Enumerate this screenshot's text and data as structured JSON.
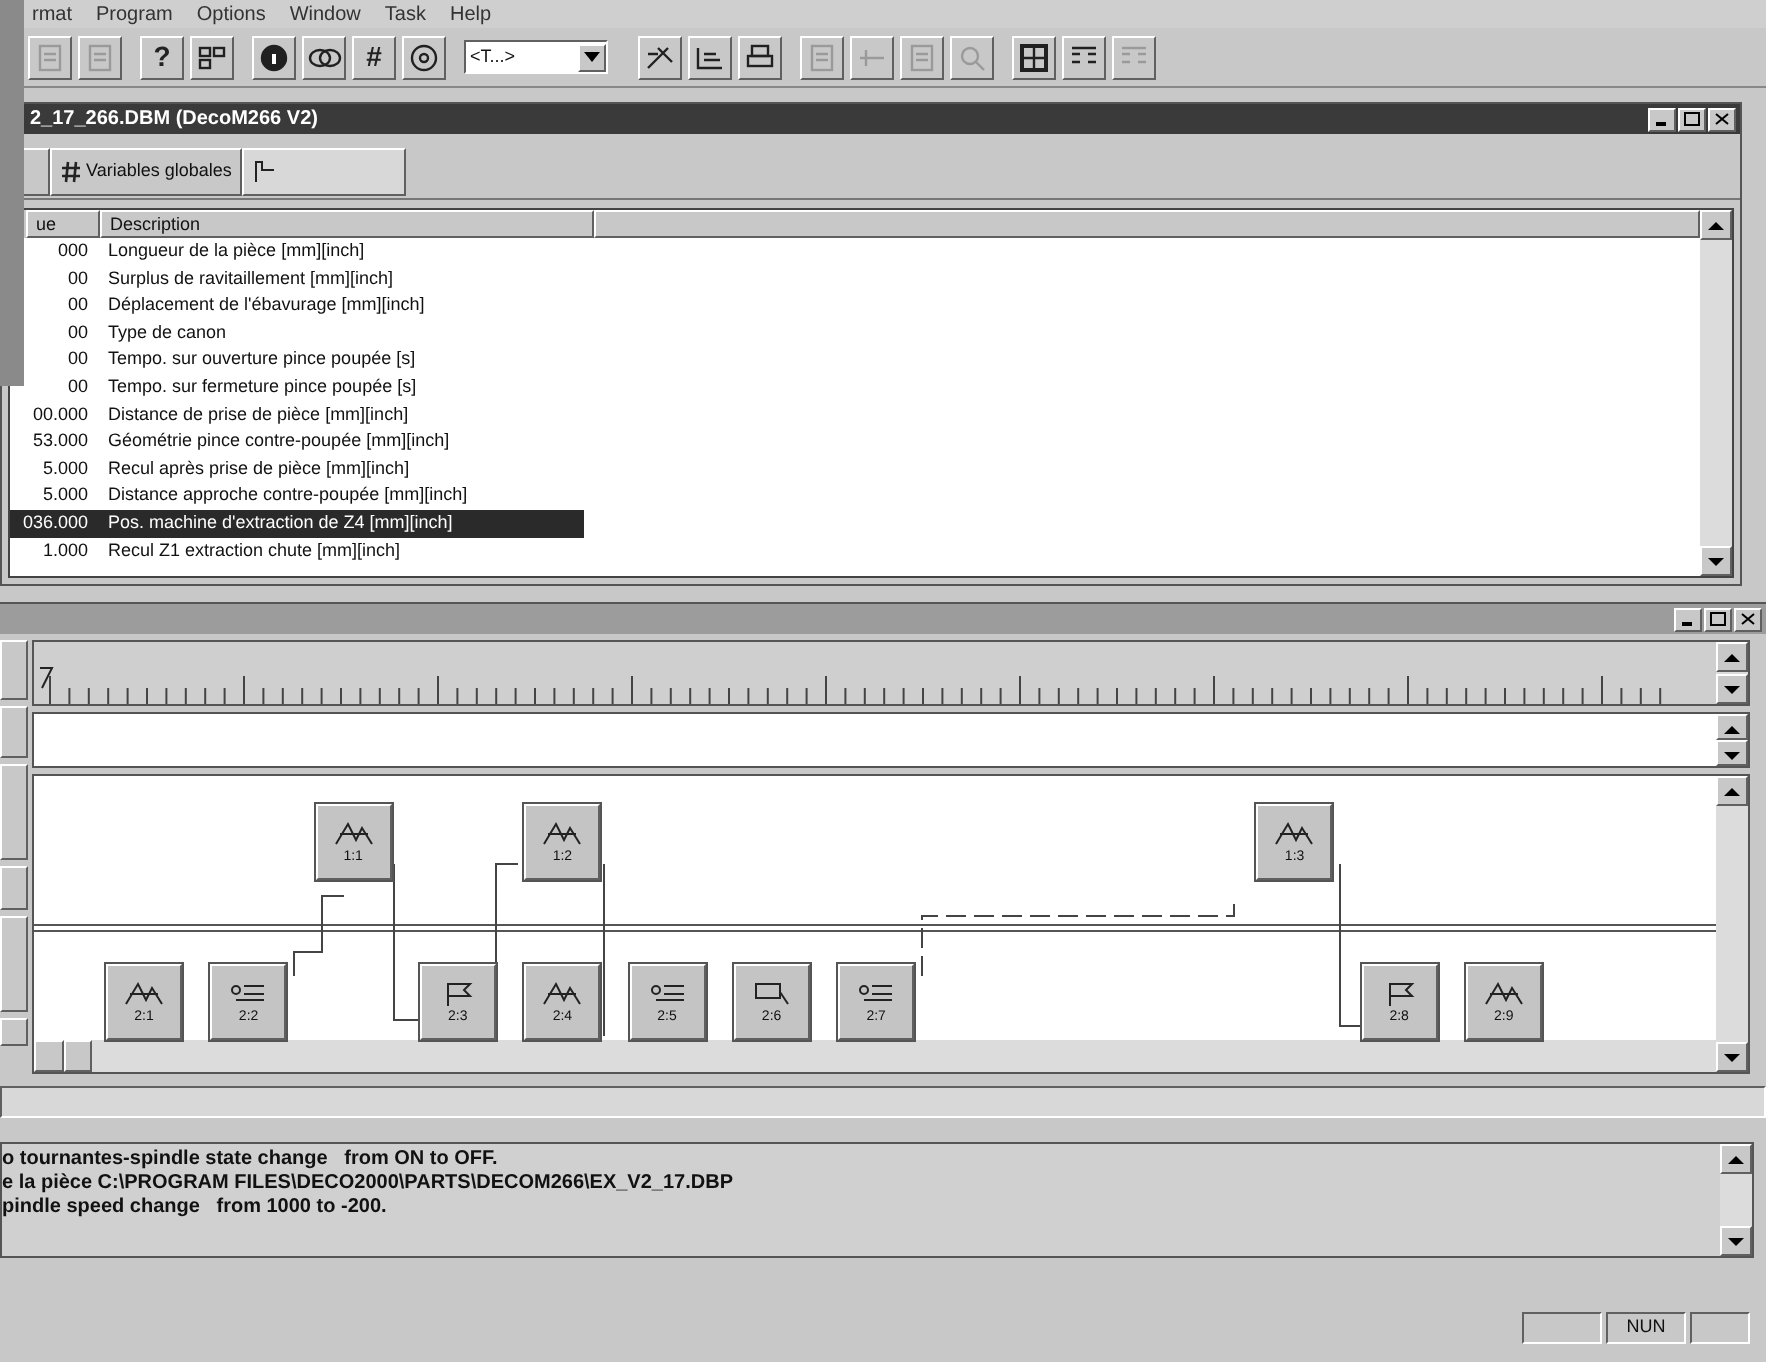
{
  "menu_bar": [
    "rmat",
    "Program",
    "Options",
    "Window",
    "Task",
    "Help"
  ],
  "toolbar": [
    {
      "kind": "page",
      "disabled": true
    },
    {
      "kind": "page",
      "disabled": true
    },
    {
      "kind": "glyph",
      "label": "?",
      "disabled": false
    },
    {
      "kind": "grid",
      "disabled": false
    },
    {
      "kind": "info",
      "disabled": false
    },
    {
      "kind": "link",
      "disabled": false
    },
    {
      "kind": "glyph",
      "label": "#",
      "disabled": false
    },
    {
      "kind": "disk",
      "disabled": false
    },
    {
      "kind": "combo",
      "value": "<T...>",
      "disabled": false
    },
    {
      "kind": "tool",
      "disabled": false
    },
    {
      "kind": "save",
      "disabled": false
    },
    {
      "kind": "print",
      "disabled": false
    },
    {
      "kind": "page",
      "disabled": true
    },
    {
      "kind": "cut",
      "disabled": true
    },
    {
      "kind": "page",
      "disabled": true
    },
    {
      "kind": "find",
      "disabled": true
    },
    {
      "kind": "window",
      "disabled": false
    },
    {
      "kind": "tile",
      "disabled": false
    },
    {
      "kind": "tile",
      "disabled": true
    }
  ],
  "document_window": {
    "title": "2_17_266.DBM (DecoM266 V2)",
    "tabs": [
      {
        "kind": "blank",
        "selected": false
      },
      {
        "label": "Variables globales",
        "kind": "hash",
        "selected": false
      },
      {
        "kind": "flag",
        "selected": true
      }
    ],
    "table": {
      "columns": [
        "ue",
        "Description"
      ],
      "rows": [
        {
          "value": "000",
          "description": "Longueur de la pièce [mm][inch]",
          "selected": false
        },
        {
          "value": "00",
          "description": "Surplus de ravitaillement [mm][inch]",
          "selected": false
        },
        {
          "value": "00",
          "description": "Déplacement de l'ébavurage [mm][inch]",
          "selected": false
        },
        {
          "value": "00",
          "description": "Type de canon",
          "selected": false
        },
        {
          "value": "00",
          "description": "Tempo. sur ouverture pince poupée [s]",
          "selected": false
        },
        {
          "value": "00",
          "description": "Tempo. sur fermeture pince poupée [s]",
          "selected": false
        },
        {
          "value": "00.000",
          "description": "Distance de prise de pièce [mm][inch]",
          "selected": false
        },
        {
          "value": "53.000",
          "description": "Géométrie pince contre-poupée [mm][inch]",
          "selected": false
        },
        {
          "value": "5.000",
          "description": "Recul après prise de pièce [mm][inch]",
          "selected": false
        },
        {
          "value": "5.000",
          "description": "Distance approche contre-poupée [mm][inch]",
          "selected": false
        },
        {
          "value": "036.000",
          "description": "Pos. machine d'extraction de Z4 [mm][inch]",
          "selected": true
        },
        {
          "value": "1.000",
          "description": "Recul Z1 extraction chute [mm][inch]",
          "selected": false
        }
      ]
    }
  },
  "diagram_window": {
    "lanes": [
      {
        "nodes": [
          {
            "label": "1:1",
            "kind": "spindle"
          },
          {
            "label": "1:2",
            "kind": "spindle"
          },
          {
            "label": "1:3",
            "kind": "spindle"
          }
        ]
      },
      {
        "nodes": [
          {
            "label": "2:1",
            "kind": "spindle"
          },
          {
            "label": "2:2",
            "kind": "list"
          },
          {
            "label": "2:3",
            "kind": "flag"
          },
          {
            "label": "2:4",
            "kind": "spindle"
          },
          {
            "label": "2:5",
            "kind": "list"
          },
          {
            "label": "2:6",
            "kind": "tool"
          },
          {
            "label": "2:7",
            "kind": "list"
          },
          {
            "label": "2:8",
            "kind": "flag"
          },
          {
            "label": "2:9",
            "kind": "spindle"
          }
        ]
      }
    ]
  },
  "log": [
    "o tournantes-spindle state change   from ON to OFF.",
    "e la pièce C:\\PROGRAM FILES\\DECO2000\\PARTS\\DECOM266\\EX_V2_17.DBP",
    "pindle speed change   from 1000 to -200."
  ],
  "status_bar": {
    "indicator": "NUN"
  }
}
